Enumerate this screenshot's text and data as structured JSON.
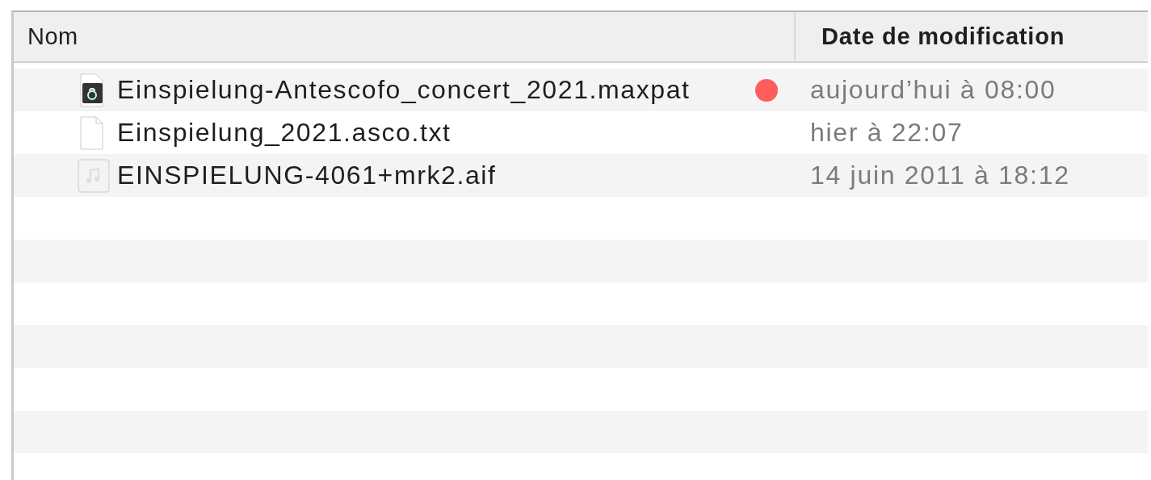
{
  "table": {
    "columns": [
      {
        "label": "Nom"
      },
      {
        "label": "Date de modification"
      }
    ],
    "rows": [
      {
        "name": "Einspielung-Antescofo_concert_2021.maxpat",
        "kind": "patch",
        "color": "#fc5d5d",
        "date": "aujourd’hui à 08:00"
      },
      {
        "name": "Einspielung_2021.asco.txt",
        "kind": "document",
        "date": "hier à 22:07"
      },
      {
        "name": "EINSPIELUNG-4061+mrk2.aif",
        "kind": "audio",
        "date": "14 juin 2011 à 18:12"
      }
    ]
  }
}
